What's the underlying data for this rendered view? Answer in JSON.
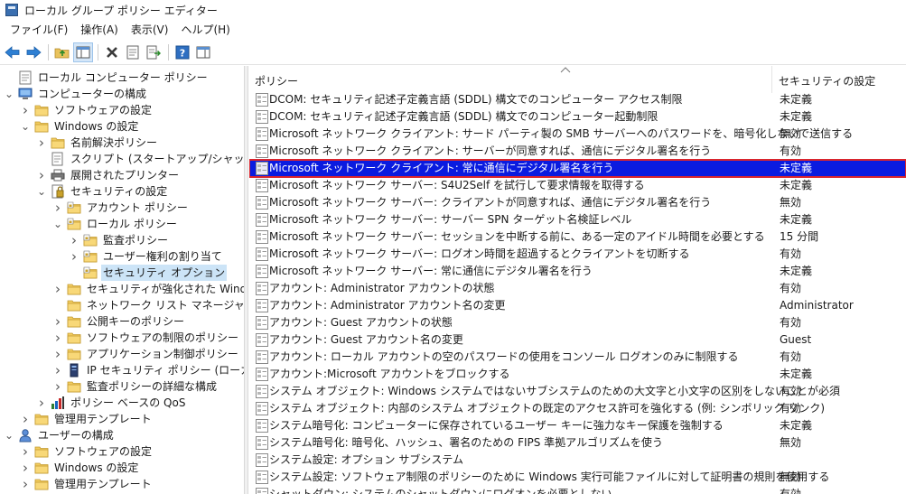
{
  "window": {
    "title": "ローカル グループ ポリシー エディター"
  },
  "menu": [
    "ファイル(F)",
    "操作(A)",
    "表示(V)",
    "ヘルプ(H)"
  ],
  "toolbar": {
    "icons": [
      "back-arrow-icon",
      "forward-arrow-icon",
      "up-folder-icon",
      "show-hide-tree-icon",
      "delete-icon",
      "properties-icon",
      "export-list-icon",
      "help-icon",
      "show-hide-action-pane-icon"
    ]
  },
  "tree": [
    {
      "label": "ローカル コンピューター ポリシー",
      "level": 0,
      "twisty": "",
      "icon": "computer-policy"
    },
    {
      "label": "コンピューターの構成",
      "level": 0,
      "twisty": "open",
      "icon": "computer"
    },
    {
      "label": "ソフトウェアの設定",
      "level": 1,
      "twisty": "closed",
      "icon": "folder"
    },
    {
      "label": "Windows の設定",
      "level": 1,
      "twisty": "open",
      "icon": "folder"
    },
    {
      "label": "名前解決ポリシー",
      "level": 2,
      "twisty": "closed",
      "icon": "folder"
    },
    {
      "label": "スクリプト (スタートアップ/シャットダウン)",
      "level": 2,
      "twisty": "",
      "icon": "script"
    },
    {
      "label": "展開されたプリンター",
      "level": 2,
      "twisty": "closed",
      "icon": "printer"
    },
    {
      "label": "セキュリティの設定",
      "level": 2,
      "twisty": "open",
      "icon": "security"
    },
    {
      "label": "アカウント ポリシー",
      "level": 3,
      "twisty": "closed",
      "icon": "lock-folder"
    },
    {
      "label": "ローカル ポリシー",
      "level": 3,
      "twisty": "open",
      "icon": "lock-folder"
    },
    {
      "label": "監査ポリシー",
      "level": 4,
      "twisty": "closed",
      "icon": "lock-folder"
    },
    {
      "label": "ユーザー権利の割り当て",
      "level": 4,
      "twisty": "closed",
      "icon": "lock-folder"
    },
    {
      "label": "セキュリティ オプション",
      "level": 4,
      "twisty": "",
      "icon": "lock-folder",
      "selected": true
    },
    {
      "label": "セキュリティが強化された Windows",
      "level": 3,
      "twisty": "closed",
      "icon": "folder"
    },
    {
      "label": "ネットワーク リスト マネージャー ポリシ",
      "level": 3,
      "twisty": "",
      "icon": "folder"
    },
    {
      "label": "公開キーのポリシー",
      "level": 3,
      "twisty": "closed",
      "icon": "folder"
    },
    {
      "label": "ソフトウェアの制限のポリシー",
      "level": 3,
      "twisty": "closed",
      "icon": "folder"
    },
    {
      "label": "アプリケーション制御ポリシー",
      "level": 3,
      "twisty": "closed",
      "icon": "folder"
    },
    {
      "label": "IP セキュリティ ポリシー (ローカル コン",
      "level": 3,
      "twisty": "closed",
      "icon": "ip-security"
    },
    {
      "label": "監査ポリシーの詳細な構成",
      "level": 3,
      "twisty": "closed",
      "icon": "folder"
    },
    {
      "label": "ポリシー ベースの QoS",
      "level": 2,
      "twisty": "closed",
      "icon": "qos"
    },
    {
      "label": "管理用テンプレート",
      "level": 1,
      "twisty": "closed",
      "icon": "folder"
    },
    {
      "label": "ユーザーの構成",
      "level": 0,
      "twisty": "open",
      "icon": "user"
    },
    {
      "label": "ソフトウェアの設定",
      "level": 1,
      "twisty": "closed",
      "icon": "folder"
    },
    {
      "label": "Windows の設定",
      "level": 1,
      "twisty": "closed",
      "icon": "folder"
    },
    {
      "label": "管理用テンプレート",
      "level": 1,
      "twisty": "closed",
      "icon": "folder"
    }
  ],
  "list": {
    "columns": {
      "policy": "ポリシー",
      "setting": "セキュリティの設定"
    },
    "rows": [
      {
        "policy": "DCOM: セキュリティ記述子定義言語 (SDDL) 構文でのコンピューター アクセス制限",
        "setting": "未定義"
      },
      {
        "policy": "DCOM: セキュリティ記述子定義言語 (SDDL) 構文でのコンピューター起動制限",
        "setting": "未定義"
      },
      {
        "policy": "Microsoft ネットワーク クライアント: サード パーティ製の SMB サーバーへのパスワードを、暗号化しないで送信する",
        "setting": "無効"
      },
      {
        "policy": "Microsoft ネットワーク クライアント: サーバーが同意すれば、通信にデジタル署名を行う",
        "setting": "有効"
      },
      {
        "policy": "Microsoft ネットワーク クライアント: 常に通信にデジタル署名を行う",
        "setting": "未定義",
        "selected": true
      },
      {
        "policy": "Microsoft ネットワーク サーバー: S4U2Self を試行して要求情報を取得する",
        "setting": "未定義"
      },
      {
        "policy": "Microsoft ネットワーク サーバー: クライアントが同意すれば、通信にデジタル署名を行う",
        "setting": "無効"
      },
      {
        "policy": "Microsoft ネットワーク サーバー: サーバー SPN ターゲット名検証レベル",
        "setting": "未定義"
      },
      {
        "policy": "Microsoft ネットワーク サーバー: セッションを中断する前に、ある一定のアイドル時間を必要とする",
        "setting": "15 分間"
      },
      {
        "policy": "Microsoft ネットワーク サーバー: ログオン時間を超過するとクライアントを切断する",
        "setting": "有効"
      },
      {
        "policy": "Microsoft ネットワーク サーバー: 常に通信にデジタル署名を行う",
        "setting": "未定義"
      },
      {
        "policy": "アカウント: Administrator アカウントの状態",
        "setting": "有効"
      },
      {
        "policy": "アカウント: Administrator アカウント名の変更",
        "setting": "Administrator"
      },
      {
        "policy": "アカウント: Guest アカウントの状態",
        "setting": "有効"
      },
      {
        "policy": "アカウント: Guest アカウント名の変更",
        "setting": "Guest"
      },
      {
        "policy": "アカウント: ローカル アカウントの空のパスワードの使用をコンソール ログオンのみに制限する",
        "setting": "有効"
      },
      {
        "policy": "アカウント:Microsoft アカウントをブロックする",
        "setting": "未定義"
      },
      {
        "policy": "システム オブジェクト: Windows システムではないサブシステムのための大文字と小文字の区別をしないことが必須",
        "setting": "有効"
      },
      {
        "policy": "システム オブジェクト: 内部のシステム オブジェクトの既定のアクセス許可を強化する (例: シンボリック リンク)",
        "setting": "有効"
      },
      {
        "policy": "システム暗号化: コンピューターに保存されているユーザー キーに強力なキー保護を強制する",
        "setting": "未定義"
      },
      {
        "policy": "システム暗号化: 暗号化、ハッシュ、署名のための FIPS 準拠アルゴリズムを使う",
        "setting": "無効"
      },
      {
        "policy": "システム設定: オプション サブシステム",
        "setting": ""
      },
      {
        "policy": "システム設定: ソフトウェア制限のポリシーのために Windows 実行可能ファイルに対して証明書の規則を使用する",
        "setting": "無効"
      },
      {
        "policy": "シャットダウン: システムのシャットダウンにログオンを必要としない",
        "setting": "有効"
      }
    ]
  }
}
